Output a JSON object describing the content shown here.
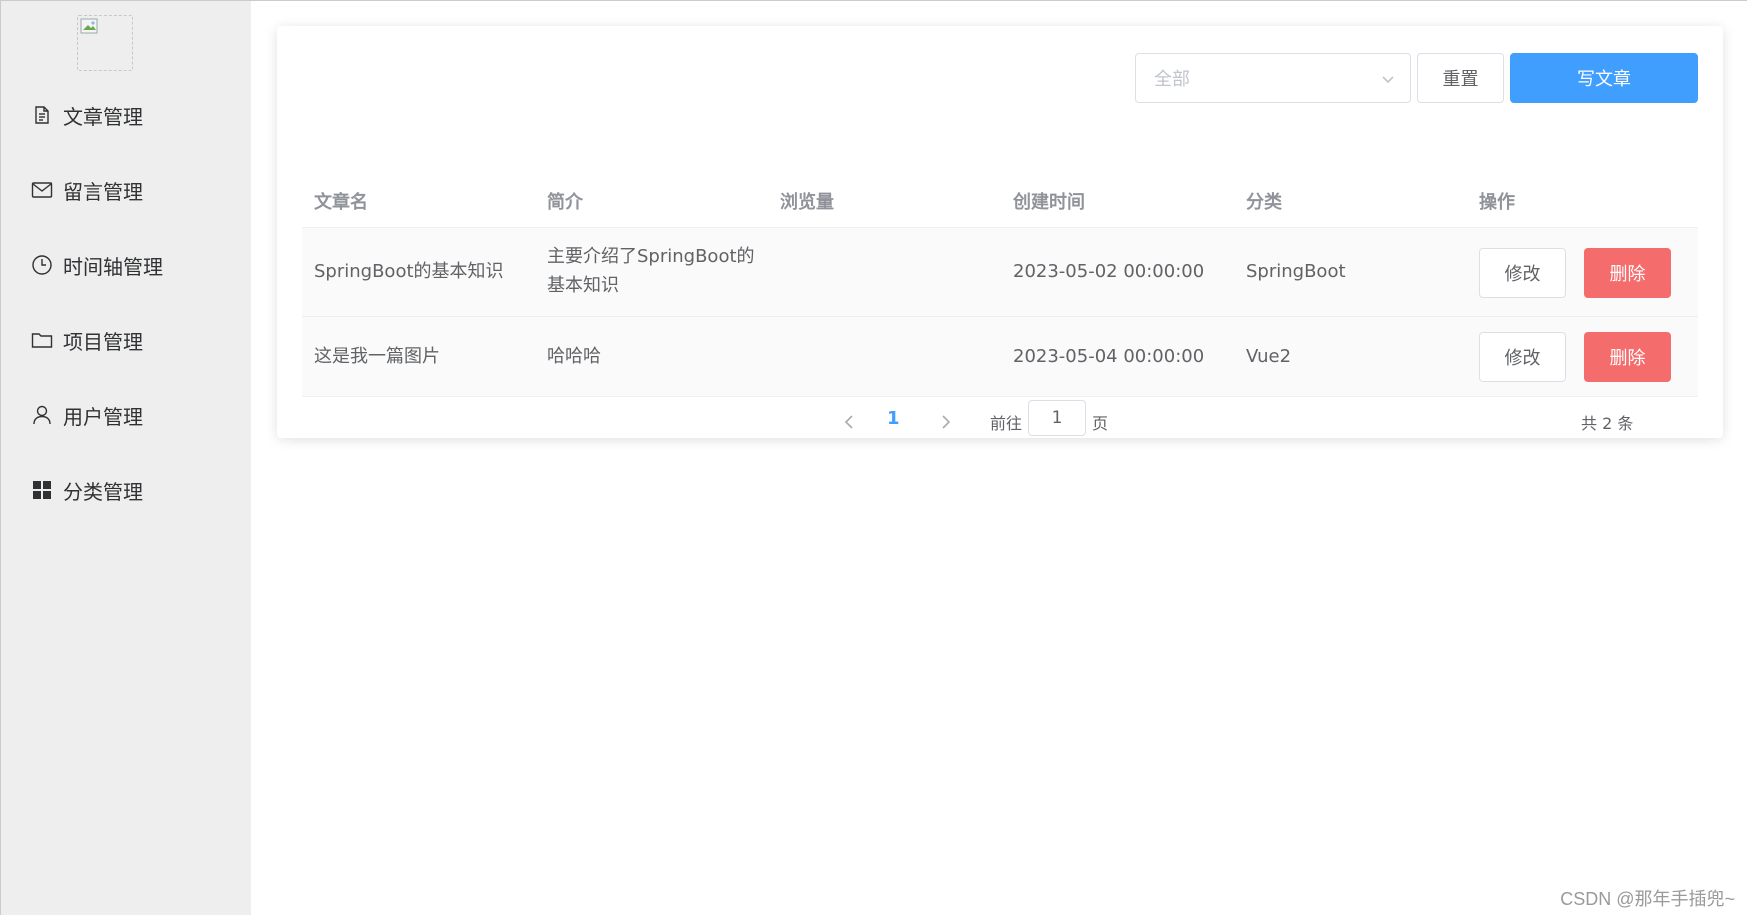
{
  "sidebar": {
    "logo_alt": "",
    "items": [
      {
        "label": "文章管理",
        "icon": "document-icon"
      },
      {
        "label": "留言管理",
        "icon": "message-icon"
      },
      {
        "label": "时间轴管理",
        "icon": "clock-icon"
      },
      {
        "label": "项目管理",
        "icon": "folder-icon"
      },
      {
        "label": "用户管理",
        "icon": "user-icon"
      },
      {
        "label": "分类管理",
        "icon": "grid-icon"
      }
    ]
  },
  "toolbar": {
    "category_select": {
      "placeholder": "全部"
    },
    "reset_label": "重置",
    "write_label": "写文章"
  },
  "table": {
    "columns": [
      "文章名",
      "简介",
      "浏览量",
      "创建时间",
      "分类",
      "操作"
    ],
    "rows": [
      {
        "title": "SpringBoot的基本知识",
        "summary_line1": "主要介绍了SpringBoot的",
        "summary_line2": "基本知识",
        "views": "",
        "created": "2023-05-02 00:00:00",
        "category": "SpringBoot",
        "edit_label": "修改",
        "delete_label": "删除"
      },
      {
        "title": "这是我一篇图片",
        "summary_line1": "哈哈哈",
        "summary_line2": "",
        "views": "",
        "created": "2023-05-04 00:00:00",
        "category": "Vue2",
        "edit_label": "修改",
        "delete_label": "删除"
      }
    ]
  },
  "pagination": {
    "current_page": "1",
    "goto_label": "前往",
    "goto_value": "1",
    "page_label": "页",
    "total_label": "共 2 条"
  },
  "watermark": "CSDN @那年手插兜~",
  "colors": {
    "primary": "#409eff",
    "danger": "#f56c6c",
    "sidebar_bg": "#eeeeee"
  }
}
